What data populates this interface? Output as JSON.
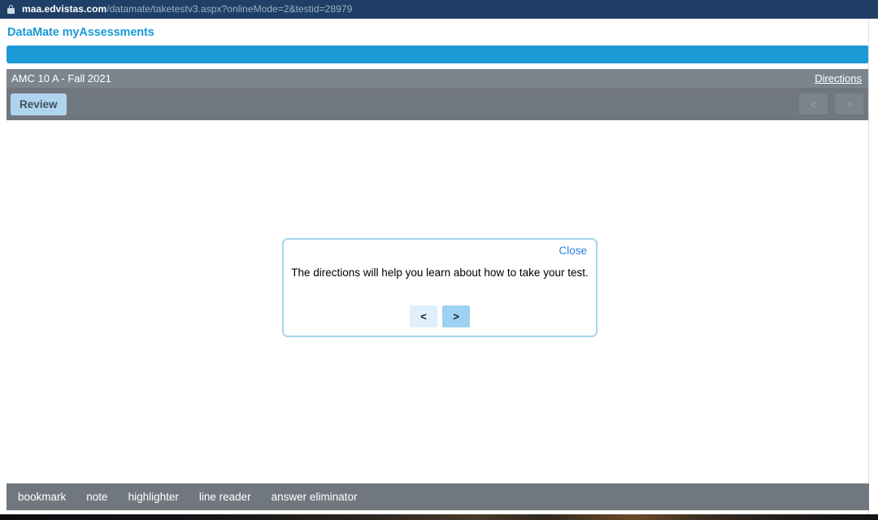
{
  "browser": {
    "lock_icon": "lock-icon",
    "url_domain": "maa.edvistas.com",
    "url_path": "/datamate/taketestv3.aspx?onlineMode=2&testid=28979"
  },
  "app": {
    "title": "DataMate myAssessments"
  },
  "test_header": {
    "title": "AMC 10 A - Fall 2021",
    "directions_label": "Directions",
    "review_label": "Review",
    "prev_label": "<",
    "next_label": ">"
  },
  "modal": {
    "close_label": "Close",
    "message": "The directions will help you learn about how to take your test.",
    "prev_label": "<",
    "next_label": ">"
  },
  "tools": [
    {
      "label": "bookmark"
    },
    {
      "label": "note"
    },
    {
      "label": "highlighter"
    },
    {
      "label": "line reader"
    },
    {
      "label": "answer eliminator"
    }
  ],
  "colors": {
    "brand_blue": "#1b9ad6",
    "link_blue": "#2d7fe0",
    "header_gray": "#7c858e",
    "toolbar_gray": "#71777e",
    "modal_border": "#a3d4f0",
    "review_button": "#aed4ee",
    "url_bar": "#1f3f66"
  }
}
